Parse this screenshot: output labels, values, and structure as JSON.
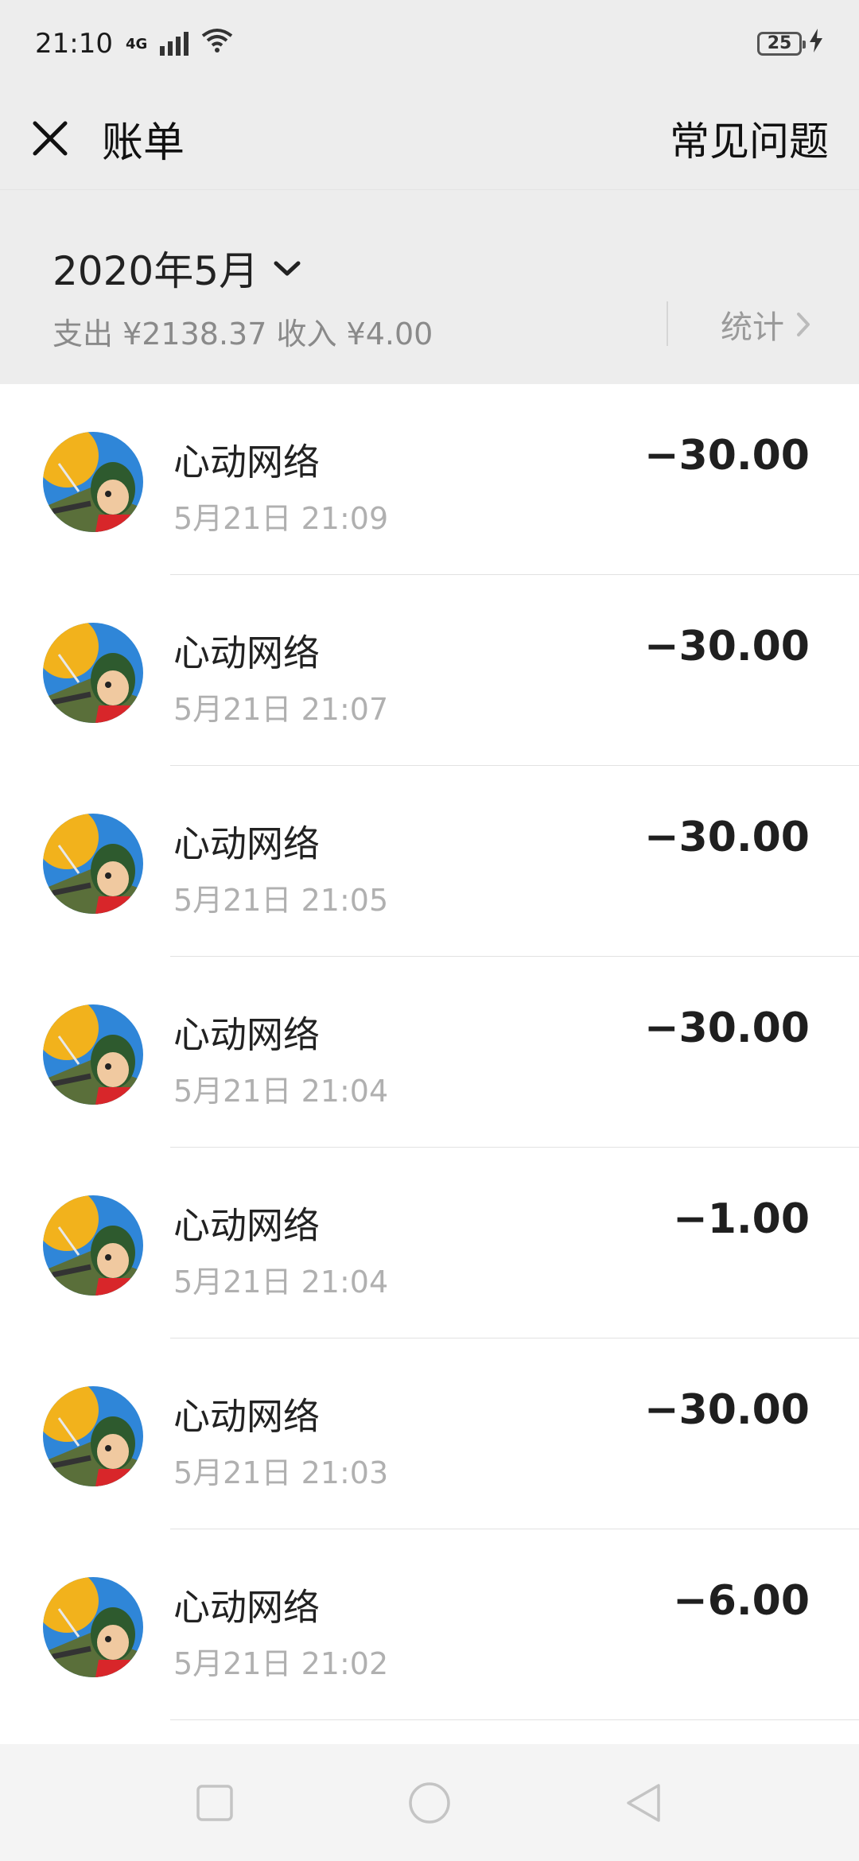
{
  "status_bar": {
    "time": "21:10",
    "network": "4G",
    "battery": "25"
  },
  "header": {
    "title": "账单",
    "faq": "常见问题"
  },
  "summary": {
    "month": "2020年5月",
    "totals": "支出 ¥2138.37 收入 ¥4.00",
    "stats_label": "统计"
  },
  "transactions": [
    {
      "merchant": "心动网络",
      "time": "5月21日 21:09",
      "amount": "−30.00"
    },
    {
      "merchant": "心动网络",
      "time": "5月21日 21:07",
      "amount": "−30.00"
    },
    {
      "merchant": "心动网络",
      "time": "5月21日 21:05",
      "amount": "−30.00"
    },
    {
      "merchant": "心动网络",
      "time": "5月21日 21:04",
      "amount": "−30.00"
    },
    {
      "merchant": "心动网络",
      "time": "5月21日 21:04",
      "amount": "−1.00"
    },
    {
      "merchant": "心动网络",
      "time": "5月21日 21:03",
      "amount": "−30.00"
    },
    {
      "merchant": "心动网络",
      "time": "5月21日 21:02",
      "amount": "−6.00"
    }
  ],
  "icons": {
    "close": "close-icon",
    "dropdown": "chevron-down-icon",
    "stats_arrow": "chevron-right-icon",
    "nav_recent": "square-icon",
    "nav_home": "circle-icon",
    "nav_back": "triangle-back-icon"
  }
}
